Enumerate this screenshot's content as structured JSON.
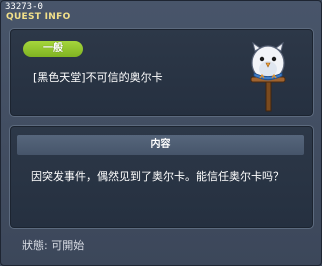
{
  "header": {
    "quest_id": "33273-0",
    "title": "QUEST INFO"
  },
  "quest": {
    "category": "一般",
    "name": "[黑色天堂]不可信的奥尔卡"
  },
  "content": {
    "header": "内容",
    "text": "因突发事件，偶然见到了奥尔卡。能信任奥尔卡吗？"
  },
  "status": {
    "text": "狀態: 可開始"
  },
  "colors": {
    "title_yellow": "#f2e08a",
    "badge_green": "#8cc22c",
    "panel_bg": "#283344",
    "window_bg": "#42505f"
  },
  "icons": {
    "npc_portrait": "owl-on-signpost-icon"
  }
}
